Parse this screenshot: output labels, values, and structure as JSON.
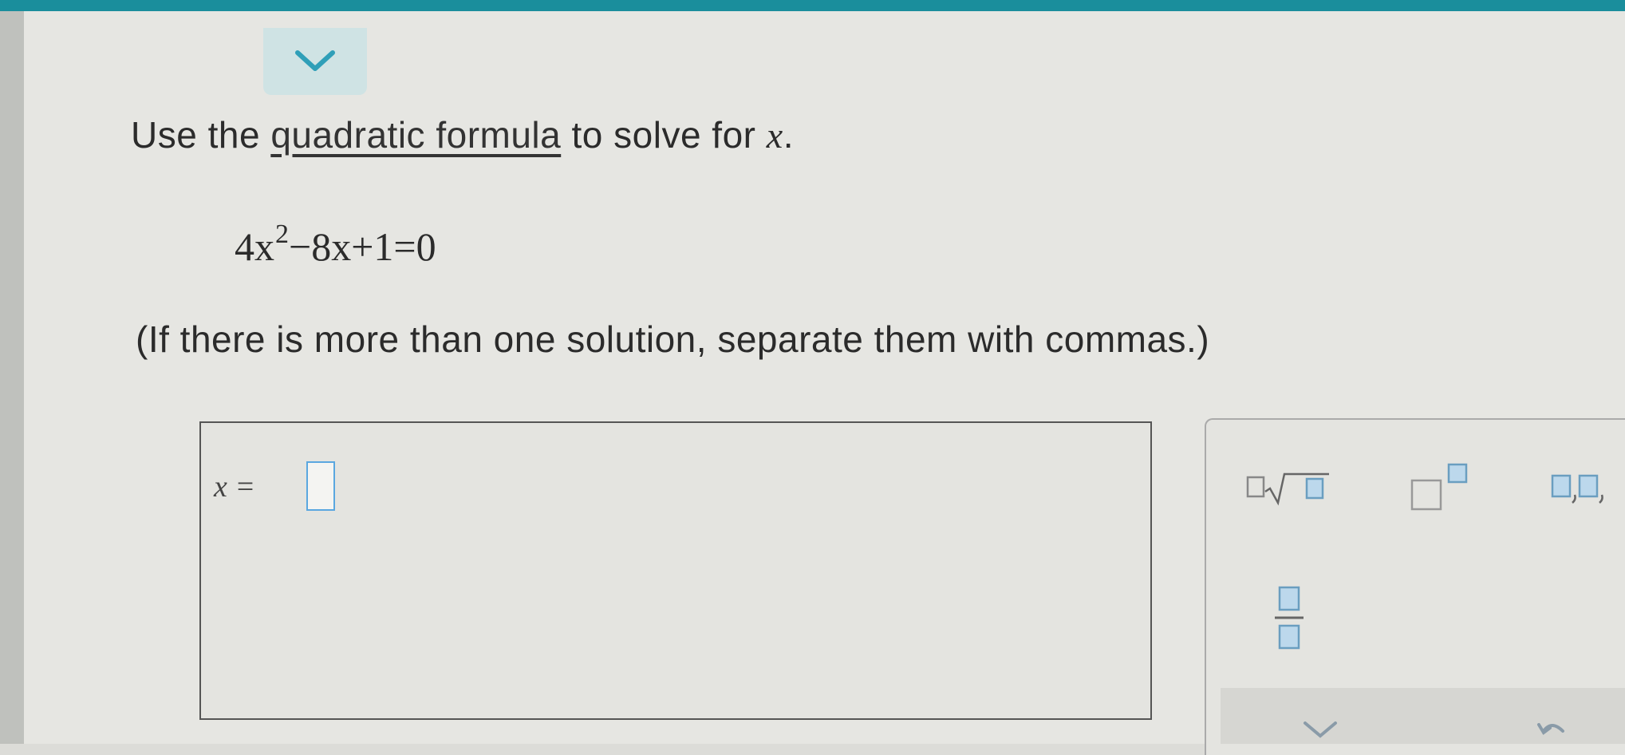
{
  "question": {
    "prompt_before": "Use the ",
    "prompt_link": "quadratic formula",
    "prompt_after": " to solve for ",
    "prompt_var": "x",
    "prompt_end": ".",
    "equation": {
      "coef": "4x",
      "exponent": "2",
      "rest": "−8x+1=0"
    },
    "note": "(If there is more than one solution, separate them with commas.)"
  },
  "answer": {
    "label": "x =",
    "value": ""
  },
  "palette": {
    "tools": [
      {
        "name": "nth-root",
        "icon": "nth-root-icon"
      },
      {
        "name": "exponent",
        "icon": "superscript-icon"
      },
      {
        "name": "comma-list",
        "icon": "comma-list-icon"
      },
      {
        "name": "fraction",
        "icon": "fraction-icon"
      }
    ]
  },
  "colors": {
    "top_bar": "#1a8e9c",
    "accent": "#5aa7e0",
    "tab": "#cfe3e4"
  }
}
